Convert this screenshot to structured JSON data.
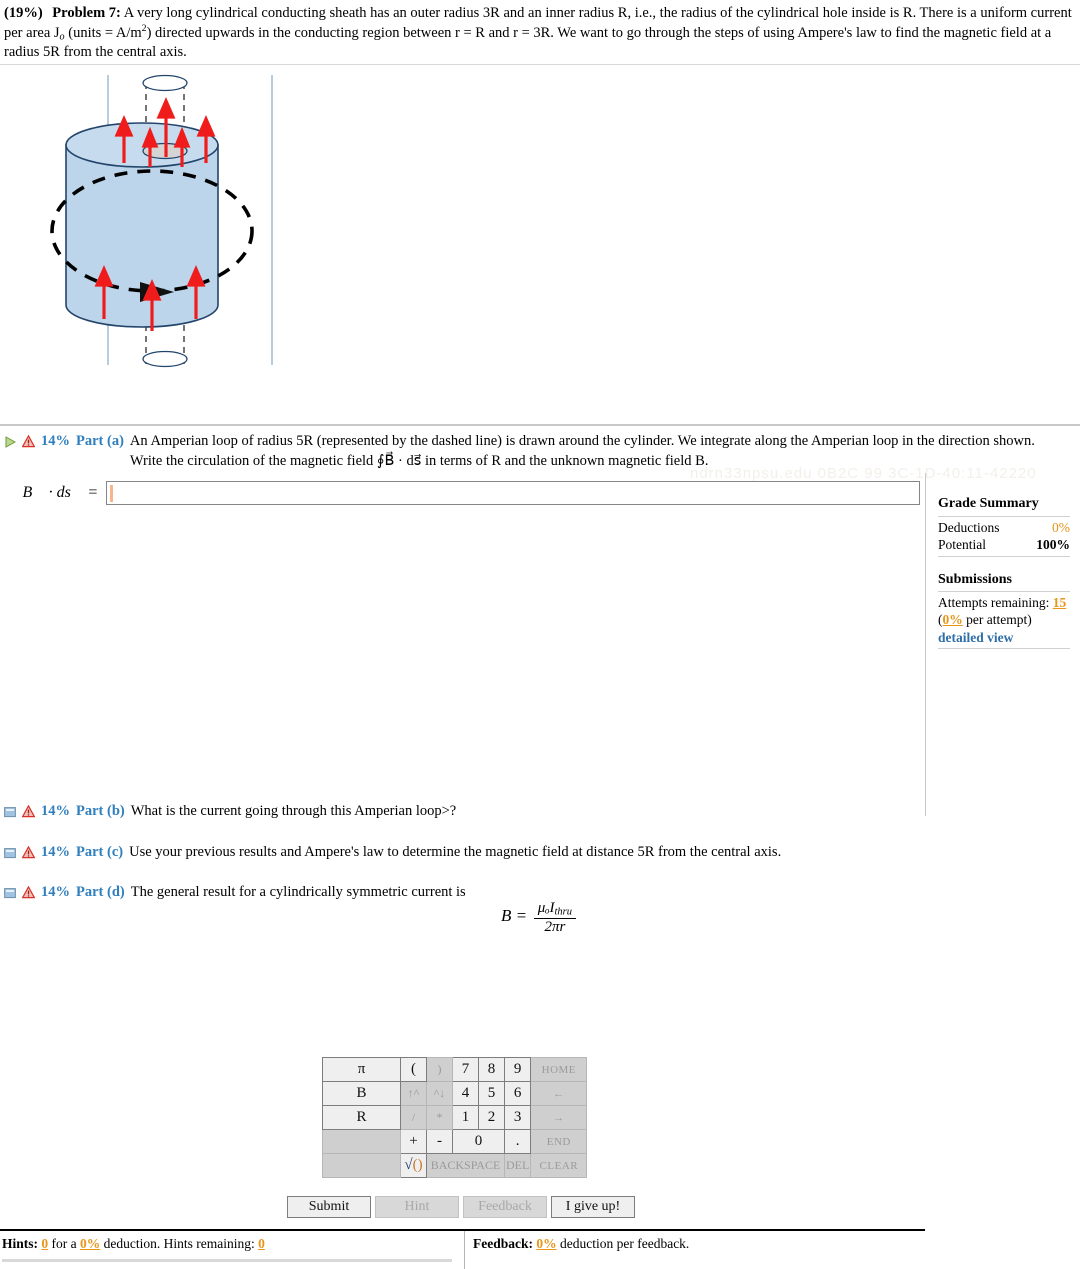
{
  "problem": {
    "percent": "(19%)",
    "label": "Problem 7:",
    "text_1": "A very long cylindrical conducting sheath has an outer radius 3R and an inner radius R, i.e., the radius of the cylindrical hole inside is R. There is a uniform current per area J",
    "sub_o": "o",
    "text_2": " (units = A/m",
    "sup_2": "2",
    "text_3": ") directed upwards in the conducting region between r = R and r = 3R. We want to go through the steps of using Ampere's law to find the magnetic field at a radius 5R from the central axis."
  },
  "watermark": "ndrn33npsu.edu 0B2C 99 3C-1D-40:11-42220",
  "part_a": {
    "percent": "14%",
    "name": "Part (a)",
    "text": "An Amperian loop of radius 5R (represented by the dashed line) is drawn around the cylinder. We integrate along the Amperian loop in the direction shown. Write the circulation of the magnetic field ∮B⃗ · ds⃗ in terms of R and the unknown magnetic field B.",
    "answer_label": "∮ B⃗ · ds⃗ =",
    "answer_value": ""
  },
  "grade_summary": {
    "title": "Grade Summary",
    "rows": [
      {
        "label": "Deductions",
        "value": "0%",
        "value_color": "orange"
      },
      {
        "label": "Potential",
        "value": "100%",
        "value_color": "black"
      }
    ],
    "submissions_title": "Submissions",
    "attempts_label": "Attempts remaining:",
    "attempts_value": "15",
    "per_attempt_pct": "0%",
    "per_attempt_text": " per attempt)",
    "per_attempt_open": "(",
    "detailed_view": "detailed view"
  },
  "keypad": {
    "rows": [
      [
        {
          "label": "π",
          "type": "key var",
          "rowspan": 1
        },
        {
          "label": "(",
          "type": "key op"
        },
        {
          "label": ")",
          "type": "blank op"
        },
        {
          "label": "7",
          "type": "key num"
        },
        {
          "label": "8",
          "type": "key num"
        },
        {
          "label": "9",
          "type": "key num"
        },
        {
          "label": "HOME",
          "type": "blank nav"
        }
      ],
      [
        {
          "label": "B",
          "type": "key var"
        },
        {
          "label": "↑^",
          "type": "blank op"
        },
        {
          "label": "^↓",
          "type": "blank op"
        },
        {
          "label": "4",
          "type": "key num"
        },
        {
          "label": "5",
          "type": "key num"
        },
        {
          "label": "6",
          "type": "key num"
        },
        {
          "label": "←",
          "type": "blank nav"
        }
      ],
      [
        {
          "label": "R",
          "type": "key var"
        },
        {
          "label": "/",
          "type": "blank op"
        },
        {
          "label": "*",
          "type": "blank op"
        },
        {
          "label": "1",
          "type": "key num"
        },
        {
          "label": "2",
          "type": "key num"
        },
        {
          "label": "3",
          "type": "key num"
        },
        {
          "label": "→",
          "type": "blank nav"
        }
      ],
      [
        {
          "label": "",
          "type": "blank var"
        },
        {
          "label": "+",
          "type": "key op"
        },
        {
          "label": "-",
          "type": "key op"
        },
        {
          "label": "0",
          "type": "key num",
          "colspan": 2
        },
        {
          "label": ".",
          "type": "key num"
        },
        {
          "label": "END",
          "type": "blank nav"
        }
      ],
      [
        {
          "label": "",
          "type": "blank var"
        },
        {
          "label": "√()",
          "type": "key op sqrt"
        },
        {
          "label": "BACKSPACE",
          "type": "blank",
          "colspan": 3
        },
        {
          "label": "DEL",
          "type": "blank num"
        },
        {
          "label": "CLEAR",
          "type": "blank nav"
        }
      ]
    ]
  },
  "buttons": [
    {
      "label": "Submit",
      "enabled": true
    },
    {
      "label": "Hint",
      "enabled": false
    },
    {
      "label": "Feedback",
      "enabled": false
    },
    {
      "label": "I give up!",
      "enabled": true
    }
  ],
  "hints_bar": {
    "hints_label": "Hints:",
    "hints_count": "0",
    "for_a": "for a",
    "hints_pct": "0%",
    "deduction_text": "deduction. Hints remaining:",
    "hints_remaining": "0",
    "feedback_label": "Feedback:",
    "feedback_pct": "0%",
    "feedback_text": "deduction per feedback."
  },
  "lower_parts": [
    {
      "percent": "14%",
      "name": "Part (b)",
      "text": "What is the current going through this Amperian loop>?"
    },
    {
      "percent": "14%",
      "name": "Part (c)",
      "text": "Use your previous results and Ampere's law to determine the magnetic field at distance 5R from the central axis."
    },
    {
      "percent": "14%",
      "name": "Part (d)",
      "text": "The general result for a cylindrically symmetric current is"
    }
  ],
  "final_formula": {
    "lhs": "B =",
    "numerator": "μₒI",
    "numerator_sub": "thru",
    "denominator": "2πr"
  },
  "figure": {
    "caption": "cylindrical conducting sheath with upward current arrows and dashed Amperian loop",
    "colors": {
      "cylinder_fill": "#bcd5ea",
      "cylinder_stroke": "#23456b",
      "arrow_red": "#f01c1c",
      "axis_line": "#7fa8c9",
      "dashed_loop": "#000000",
      "hole_fill": "#d4d4d4"
    }
  },
  "colors": {
    "accent_blue": "#2f7fbf",
    "orange": "#E8951A",
    "link_blue": "#2f6fa8",
    "warn_red": "#d93025"
  }
}
